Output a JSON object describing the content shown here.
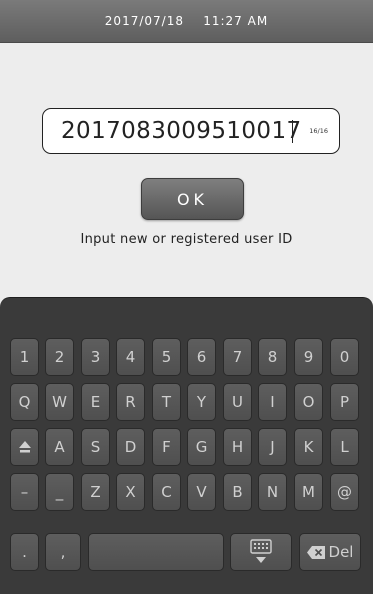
{
  "status_bar": {
    "datetime": "2017/07/18    11:27 AM"
  },
  "input": {
    "value": "2017083009510017",
    "char_count": "16/16"
  },
  "ok_button": {
    "label": "OK"
  },
  "hint": "Input new or registered user ID",
  "keyboard": {
    "row1": [
      "1",
      "2",
      "3",
      "4",
      "5",
      "6",
      "7",
      "8",
      "9",
      "0"
    ],
    "row2": [
      "Q",
      "W",
      "E",
      "R",
      "T",
      "Y",
      "U",
      "I",
      "O",
      "P"
    ],
    "row3": [
      "A",
      "S",
      "D",
      "F",
      "G",
      "H",
      "J",
      "K",
      "L"
    ],
    "row4": [
      "–",
      "_",
      "Z",
      "X",
      "C",
      "V",
      "B",
      "N",
      "M",
      "@"
    ],
    "row5": {
      "period": ".",
      "comma": ",",
      "space": "",
      "del_label": "Del"
    },
    "icons": {
      "shift": "shift-arrow-icon",
      "hide_keyboard": "keyboard-hide-icon",
      "backspace": "backspace-x-icon"
    }
  }
}
